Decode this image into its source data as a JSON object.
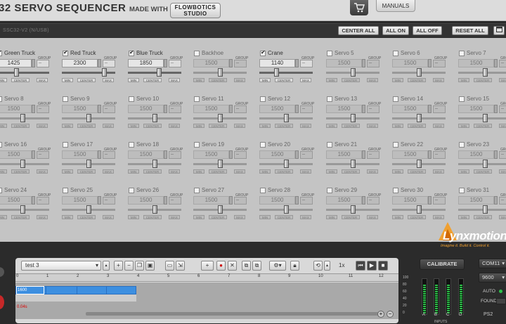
{
  "header": {
    "title": "32 SERVO SEQUENCER",
    "made_with": "MADE WITH",
    "logo_line1": "FLOWBOTICS",
    "logo_line2": "STUDIO",
    "manuals": "MANUALS",
    "cart_icon": "shopping-cart-icon"
  },
  "toolbar": {
    "port": "SSC32-V2 (N/USB)",
    "center_all": "CENTER ALL",
    "all_on": "ALL ON",
    "all_off": "ALL OFF",
    "reset_all": "RESET ALL",
    "window_icon": "window-icon"
  },
  "servo_labels": {
    "group": "GROUP",
    "min": "MIN",
    "center": "CENTER",
    "max": "MAX"
  },
  "servos": [
    {
      "name": "Green Truck",
      "checked": true,
      "value": "1425",
      "group": "--",
      "position": 0.38
    },
    {
      "name": "Red Truck",
      "checked": true,
      "value": "2300",
      "group": "--",
      "position": 0.82
    },
    {
      "name": "Blue Truck",
      "checked": true,
      "value": "1850",
      "group": "--",
      "position": 0.6
    },
    {
      "name": "Backhoe",
      "checked": false,
      "value": "1500",
      "group": "--",
      "position": 0.5
    },
    {
      "name": "Crane",
      "checked": true,
      "value": "1140",
      "group": "--",
      "position": 0.3
    },
    {
      "name": "Servo 5",
      "checked": false,
      "value": "1500",
      "group": "--",
      "position": 0.5
    },
    {
      "name": "Servo 6",
      "checked": false,
      "value": "1500",
      "group": "--",
      "position": 0.5
    },
    {
      "name": "Servo 7",
      "checked": false,
      "value": "1500",
      "group": "--",
      "position": 0.5
    },
    {
      "name": "Servo 8",
      "checked": false,
      "value": "1500",
      "group": "--",
      "position": 0.5
    },
    {
      "name": "Servo 9",
      "checked": false,
      "value": "1500",
      "group": "--",
      "position": 0.5
    },
    {
      "name": "Servo 10",
      "checked": false,
      "value": "1500",
      "group": "--",
      "position": 0.5
    },
    {
      "name": "Servo 11",
      "checked": false,
      "value": "1500",
      "group": "--",
      "position": 0.5
    },
    {
      "name": "Servo 12",
      "checked": false,
      "value": "1500",
      "group": "--",
      "position": 0.5
    },
    {
      "name": "Servo 13",
      "checked": false,
      "value": "1500",
      "group": "--",
      "position": 0.5
    },
    {
      "name": "Servo 14",
      "checked": false,
      "value": "1500",
      "group": "--",
      "position": 0.5
    },
    {
      "name": "Servo 15",
      "checked": false,
      "value": "1500",
      "group": "--",
      "position": 0.5
    },
    {
      "name": "Servo 16",
      "checked": false,
      "value": "1500",
      "group": "--",
      "position": 0.5
    },
    {
      "name": "Servo 17",
      "checked": false,
      "value": "1500",
      "group": "--",
      "position": 0.5
    },
    {
      "name": "Servo 18",
      "checked": false,
      "value": "1500",
      "group": "--",
      "position": 0.5
    },
    {
      "name": "Servo 19",
      "checked": false,
      "value": "1500",
      "group": "--",
      "position": 0.5
    },
    {
      "name": "Servo 20",
      "checked": false,
      "value": "1500",
      "group": "--",
      "position": 0.5
    },
    {
      "name": "Servo 21",
      "checked": false,
      "value": "1500",
      "group": "--",
      "position": 0.5
    },
    {
      "name": "Servo 22",
      "checked": false,
      "value": "1500",
      "group": "--",
      "position": 0.5
    },
    {
      "name": "Servo 23",
      "checked": false,
      "value": "1500",
      "group": "--",
      "position": 0.5
    },
    {
      "name": "Servo 24",
      "checked": false,
      "value": "1500",
      "group": "--",
      "position": 0.5
    },
    {
      "name": "Servo 25",
      "checked": false,
      "value": "1500",
      "group": "--",
      "position": 0.5
    },
    {
      "name": "Servo 26",
      "checked": false,
      "value": "1500",
      "group": "--",
      "position": 0.5
    },
    {
      "name": "Servo 27",
      "checked": false,
      "value": "1500",
      "group": "--",
      "position": 0.5
    },
    {
      "name": "Servo 28",
      "checked": false,
      "value": "1500",
      "group": "--",
      "position": 0.5
    },
    {
      "name": "Servo 29",
      "checked": false,
      "value": "1500",
      "group": "--",
      "position": 0.5
    },
    {
      "name": "Servo 30",
      "checked": false,
      "value": "1500",
      "group": "--",
      "position": 0.5
    },
    {
      "name": "Servo 31",
      "checked": false,
      "value": "1500",
      "group": "--",
      "position": 0.5
    }
  ],
  "sequencer": {
    "sequence_name": "test 3",
    "speed": "1x",
    "ruler": [
      "0",
      "1",
      "2",
      "3",
      "4",
      "5",
      "6",
      "7",
      "8",
      "9",
      "10",
      "11",
      "12"
    ],
    "frame_label": "1600",
    "frame_time": "0.04s"
  },
  "right_panel": {
    "calibrate": "CALIBRATE",
    "com_port": "COM11",
    "baud": "9600",
    "auto": "AUTO",
    "found": "FOUND",
    "ps2": "PS2",
    "brand": "Lynxmotion",
    "tagline": "Imagine it. Build it. Control it.",
    "inputs_label": "INPUTS",
    "meter_scale": [
      "100",
      "80",
      "60",
      "40",
      "20",
      "0"
    ],
    "meters": [
      {
        "label": "A",
        "level": 0.85
      },
      {
        "label": "B",
        "level": 0.85
      },
      {
        "label": "C",
        "level": 0.85
      },
      {
        "label": "D",
        "level": 0.85
      }
    ]
  },
  "colors": {
    "accent_blue": "#3d8fe0",
    "meter_green": "#2cc048",
    "brand_orange": "#f0a030"
  }
}
